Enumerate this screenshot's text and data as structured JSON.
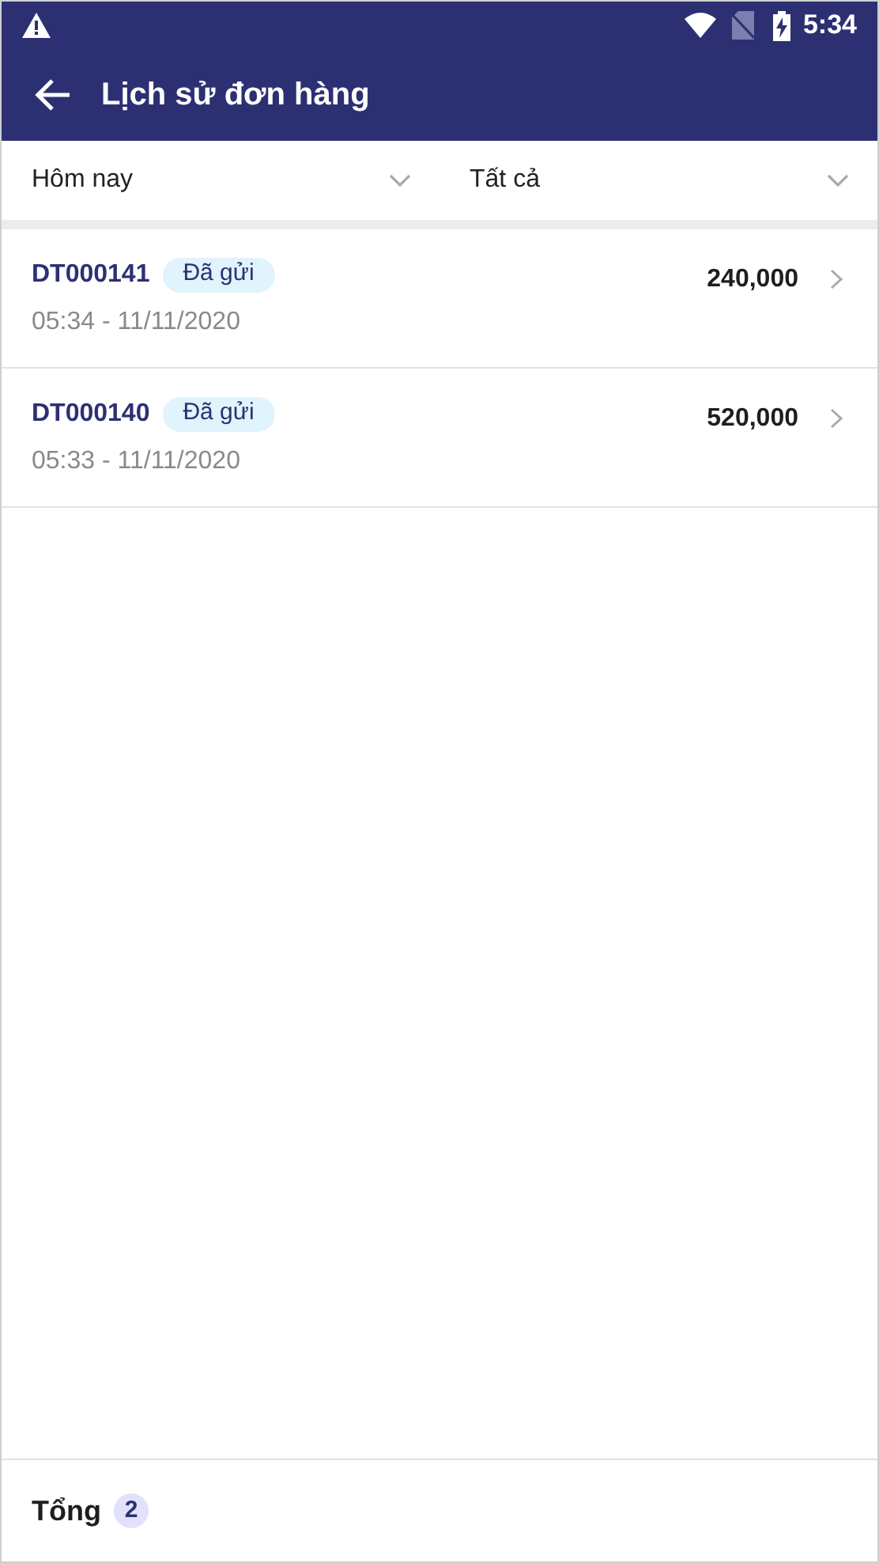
{
  "status_bar": {
    "time": "5:34"
  },
  "app_bar": {
    "title": "Lịch sử đơn hàng"
  },
  "filters": [
    {
      "label": "Hôm nay"
    },
    {
      "label": "Tất cả"
    }
  ],
  "orders": [
    {
      "code": "DT000141",
      "status": "Đã gửi",
      "time": "05:34 - 11/11/2020",
      "amount": "240,000"
    },
    {
      "code": "DT000140",
      "status": "Đã gửi",
      "time": "05:33 - 11/11/2020",
      "amount": "520,000"
    }
  ],
  "footer": {
    "label": "Tổng",
    "count": "2"
  }
}
